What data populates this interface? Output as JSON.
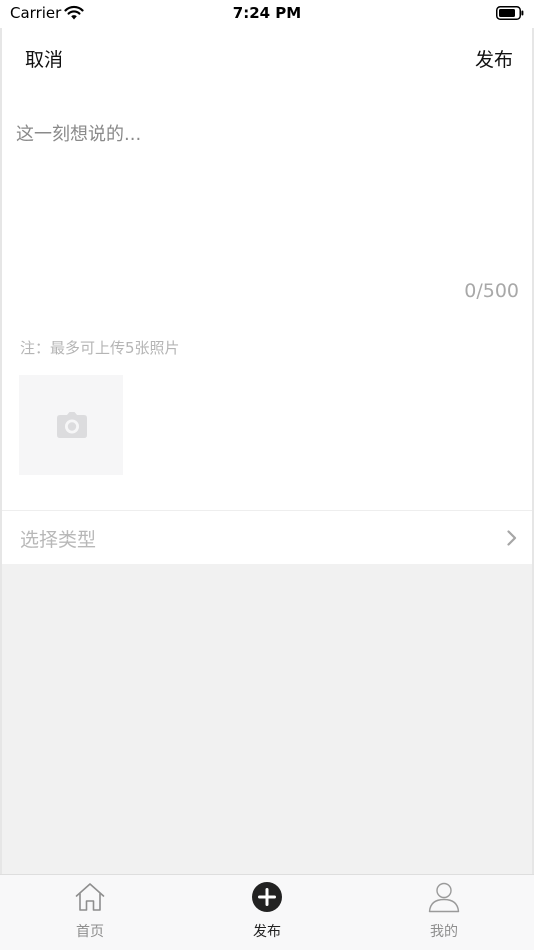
{
  "status_bar": {
    "carrier": "Carrier",
    "time": "7:24 PM"
  },
  "nav": {
    "cancel_label": "取消",
    "publish_label": "发布"
  },
  "editor": {
    "placeholder": "这一刻想说的...",
    "value": "",
    "counter": "0/500"
  },
  "upload": {
    "note": "注：最多可上传5张照片",
    "icon": "camera-icon"
  },
  "type_selector": {
    "label": "选择类型",
    "icon": "chevron-right-icon"
  },
  "tab_bar": {
    "items": [
      {
        "label": "首页",
        "icon": "home-icon",
        "active": false
      },
      {
        "label": "发布",
        "icon": "plus-circle-icon",
        "active": true
      },
      {
        "label": "我的",
        "icon": "user-icon",
        "active": false
      }
    ]
  },
  "colors": {
    "background": "#ffffff",
    "empty_area": "#f1f1f1",
    "placeholder_text": "#8a8a8a",
    "muted_text": "#b5b5b5",
    "tab_active": "#222222",
    "tab_inactive": "#8e8e8e"
  }
}
